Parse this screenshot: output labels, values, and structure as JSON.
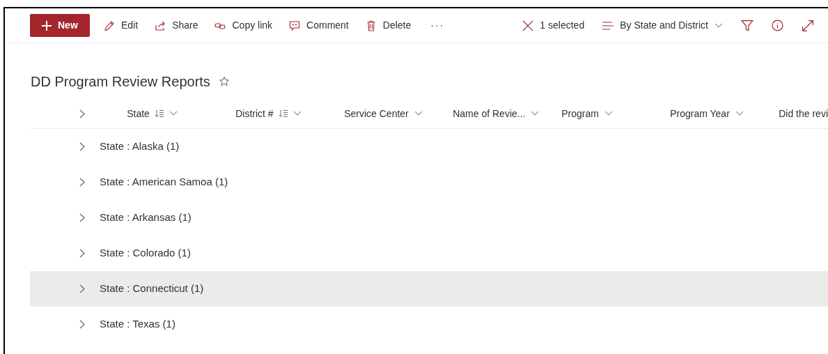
{
  "command_bar": {
    "new_button": "New",
    "actions": [
      {
        "kind": "edit",
        "label": "Edit"
      },
      {
        "kind": "share",
        "label": "Share"
      },
      {
        "kind": "link",
        "label": "Copy link"
      },
      {
        "kind": "comment",
        "label": "Comment"
      },
      {
        "kind": "delete",
        "label": "Delete"
      },
      {
        "kind": "more",
        "label": "···"
      }
    ],
    "selection": "1 selected",
    "view": "By State and District"
  },
  "list_title": "DD Program Review Reports",
  "favorite": false,
  "columns": [
    {
      "label": "State",
      "grouped": true
    },
    {
      "label": "District #",
      "grouped": true
    },
    {
      "label": "Service Center",
      "grouped": false
    },
    {
      "label": "Name of Revie...",
      "grouped": false
    },
    {
      "label": "Program",
      "grouped": false
    },
    {
      "label": "Program Year",
      "grouped": false
    },
    {
      "label": "Did the revi",
      "grouped": false
    }
  ],
  "groups": [
    {
      "label": "State : Alaska (1)",
      "selected": false
    },
    {
      "label": "State : American Samoa (1)",
      "selected": false
    },
    {
      "label": "State : Arkansas (1)",
      "selected": false
    },
    {
      "label": "State : Colorado (1)",
      "selected": false
    },
    {
      "label": "State : Connecticut (1)",
      "selected": true
    },
    {
      "label": "State : Texas (1)",
      "selected": false
    }
  ]
}
